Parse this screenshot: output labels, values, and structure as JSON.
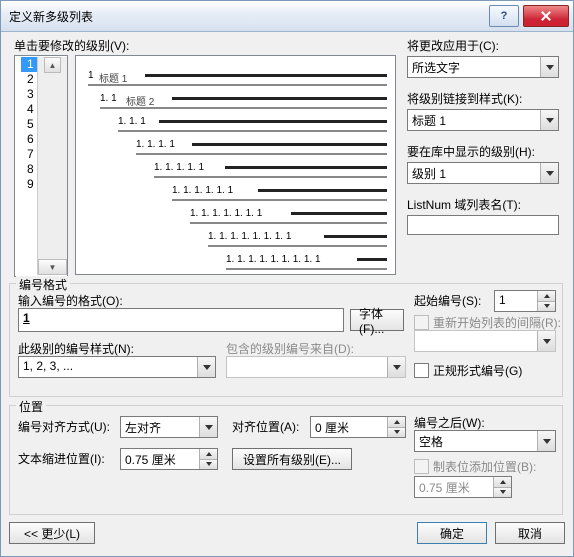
{
  "title": "定义新多级列表",
  "click_modify_label": "单击要修改的级别(V):",
  "levels": [
    "1",
    "2",
    "3",
    "4",
    "5",
    "6",
    "7",
    "8",
    "9"
  ],
  "selected_level_index": 0,
  "preview": [
    {
      "indent": 12,
      "num": "1",
      "label": "标题 1"
    },
    {
      "indent": 24,
      "num": "1. 1",
      "label": "标题 2"
    },
    {
      "indent": 42,
      "num": "1. 1. 1"
    },
    {
      "indent": 60,
      "num": "1. 1. 1. 1"
    },
    {
      "indent": 78,
      "num": "1. 1. 1. 1. 1"
    },
    {
      "indent": 96,
      "num": "1. 1. 1. 1. 1. 1"
    },
    {
      "indent": 114,
      "num": "1. 1. 1. 1. 1. 1. 1"
    },
    {
      "indent": 132,
      "num": "1. 1. 1. 1. 1. 1. 1. 1"
    },
    {
      "indent": 150,
      "num": "1. 1. 1. 1. 1. 1. 1. 1. 1"
    }
  ],
  "apply_to_label": "将更改应用于(C):",
  "apply_to_value": "所选文字",
  "link_style_label": "将级别链接到样式(K):",
  "link_style_value": "标题 1",
  "gallery_level_label": "要在库中显示的级别(H):",
  "gallery_level_value": "级别 1",
  "listnum_label": "ListNum 域列表名(T):",
  "listnum_value": "",
  "format_group": "编号格式",
  "enter_format_label": "输入编号的格式(O):",
  "enter_format_value": "1",
  "font_button": "字体(F)...",
  "num_style_label": "此级别的编号样式(N):",
  "num_style_value": "1, 2, 3, ...",
  "include_from_label": "包含的级别编号来自(D):",
  "include_from_value": "",
  "start_at_label": "起始编号(S):",
  "start_at_value": "1",
  "restart_after_label": "重新开始列表的间隔(R):",
  "restart_after_value": "",
  "legal_chk": "正规形式编号(G)",
  "position_group": "位置",
  "align_label": "编号对齐方式(U):",
  "align_value": "左对齐",
  "aligned_at_label": "对齐位置(A):",
  "aligned_at_value": "0 厘米",
  "text_indent_label": "文本缩进位置(I):",
  "text_indent_value": "0.75 厘米",
  "all_levels_button": "设置所有级别(E)...",
  "follow_label": "编号之后(W):",
  "follow_value": "空格",
  "tab_stop_label": "制表位添加位置(B):",
  "tab_stop_value": "0.75 厘米",
  "less_button": "<< 更少(L)",
  "ok_button": "确定",
  "cancel_button": "取消"
}
